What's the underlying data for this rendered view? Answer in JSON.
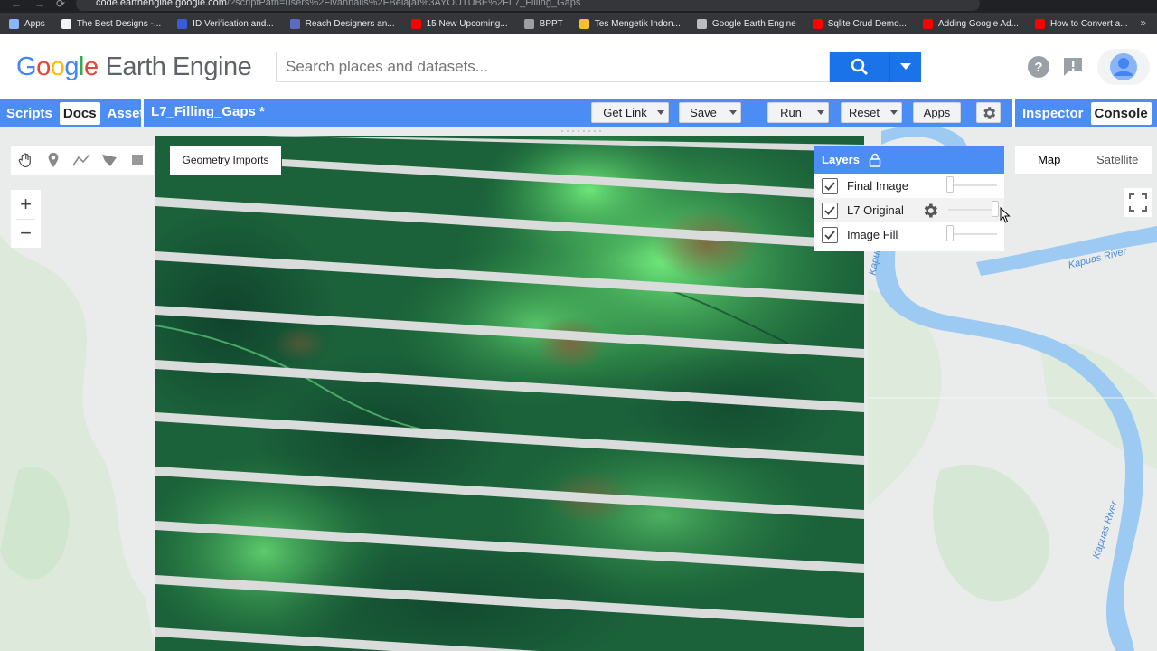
{
  "browser": {
    "url_host": "code.earthengine.google.com",
    "url_path": "/?scriptPath=users%2Fivannalis%2FBelajar%3AYOUTUBE%2FL7_Filling_Gaps",
    "bookmarks": [
      {
        "label": "Apps",
        "color": "#8ab4f8"
      },
      {
        "label": "The Best Designs -...",
        "color": "#f1f3f4"
      },
      {
        "label": "ID Verification and...",
        "color": "#3b5bdb"
      },
      {
        "label": "Reach Designers an...",
        "color": "#5c6bc0"
      },
      {
        "label": "15 New Upcoming...",
        "color": "#ff0000"
      },
      {
        "label": "BPPT",
        "color": "#9aa0a6"
      },
      {
        "label": "Tes Mengetik Indon...",
        "color": "#fbc02d"
      },
      {
        "label": "Google Earth Engine",
        "color": "#bdbdbd"
      },
      {
        "label": "Sqlite Crud Demo...",
        "color": "#ff0000"
      },
      {
        "label": "Adding Google Ad...",
        "color": "#ff0000"
      },
      {
        "label": "How to Convert a...",
        "color": "#ff0000"
      }
    ]
  },
  "header": {
    "logo_letters": [
      "G",
      "o",
      "o",
      "g",
      "l",
      "e"
    ],
    "logo_product": "Earth Engine",
    "search_placeholder": "Search places and datasets..."
  },
  "toolbar": {
    "left_tabs": [
      {
        "label": "Scripts",
        "active": false
      },
      {
        "label": "Docs",
        "active": true
      },
      {
        "label": "Assets",
        "active": false
      }
    ],
    "script_title": "L7_Filling_Gaps *",
    "get_link": "Get Link",
    "save": "Save",
    "run": "Run",
    "reset": "Reset",
    "apps": "Apps",
    "right_tabs": [
      {
        "label": "Inspector",
        "active": false
      },
      {
        "label": "Console",
        "active": true
      }
    ]
  },
  "map": {
    "geometry_imports": "Geometry Imports",
    "zoom_in": "+",
    "zoom_out": "−",
    "layers_title": "Layers",
    "layers": [
      {
        "name": "Final Image",
        "checked": true,
        "opacity": 0.0
      },
      {
        "name": "L7 Original",
        "checked": true,
        "opacity": 1.0,
        "show_gear": true
      },
      {
        "name": "Image Fill",
        "checked": true,
        "opacity": 0.0
      }
    ],
    "map_type": {
      "map": "Map",
      "satellite": "Satellite",
      "selected": "Map"
    },
    "river_labels": [
      "Kapuas River",
      "Kapuas River",
      "Kapuas"
    ]
  },
  "colors": {
    "accent_blue": "#4c8cf5",
    "search_blue": "#1a73e8",
    "river": "#9ccaf2"
  }
}
